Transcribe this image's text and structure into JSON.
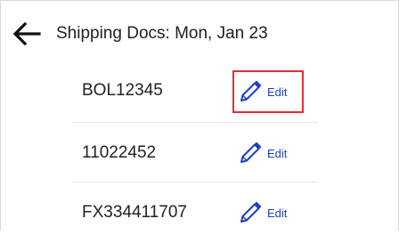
{
  "header": {
    "back_icon": "arrow-left-icon",
    "title": "Shipping Docs: Mon, Jan 23"
  },
  "docs": [
    {
      "id": "BOL12345",
      "edit_label": "Edit",
      "edit_icon": "pencil-icon"
    },
    {
      "id": "11022452",
      "edit_label": "Edit",
      "edit_icon": "pencil-icon"
    },
    {
      "id": "FX334411707",
      "edit_label": "Edit",
      "edit_icon": "pencil-icon"
    }
  ],
  "colors": {
    "accent": "#1a3fc7",
    "highlight": "#e03030",
    "text": "#202020"
  }
}
